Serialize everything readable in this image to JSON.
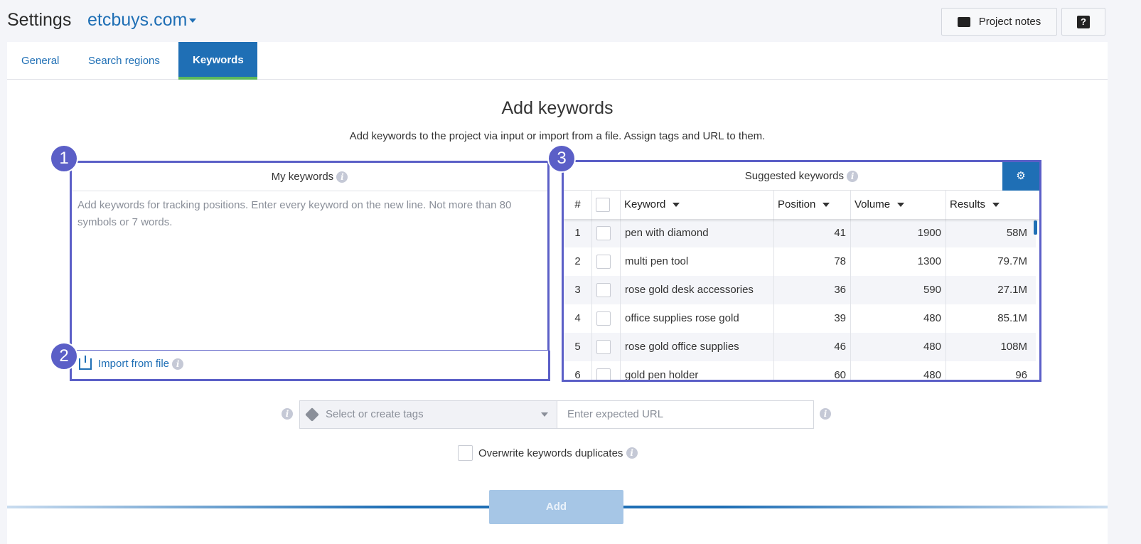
{
  "header": {
    "title": "Settings",
    "project": "etcbuys.com",
    "project_notes": "Project notes",
    "help": "?"
  },
  "tabs": [
    {
      "label": "General"
    },
    {
      "label": "Search regions"
    },
    {
      "label": "Keywords",
      "active": true
    }
  ],
  "main": {
    "title": "Add keywords",
    "subtitle": "Add keywords to the project via input or import from a file. Assign tags and URL to them."
  },
  "my_keywords": {
    "badge": "1",
    "title": "My keywords",
    "placeholder": "Add keywords for tracking positions. Enter every keyword on the new line. Not more than 80 symbols or 7 words."
  },
  "import": {
    "badge": "2",
    "label": "Import from file"
  },
  "suggested": {
    "badge": "3",
    "title": "Suggested keywords",
    "columns": [
      "#",
      "Keyword",
      "Position",
      "Volume",
      "Results"
    ],
    "rows": [
      {
        "n": "1",
        "keyword": "pen with diamond",
        "position": "41",
        "volume": "1900",
        "results": "58M"
      },
      {
        "n": "2",
        "keyword": "multi pen tool",
        "position": "78",
        "volume": "1300",
        "results": "79.7M"
      },
      {
        "n": "3",
        "keyword": "rose gold desk accessories",
        "position": "36",
        "volume": "590",
        "results": "27.1M"
      },
      {
        "n": "4",
        "keyword": "office supplies rose gold",
        "position": "39",
        "volume": "480",
        "results": "85.1M"
      },
      {
        "n": "5",
        "keyword": "rose gold office supplies",
        "position": "46",
        "volume": "480",
        "results": "108M"
      },
      {
        "n": "6",
        "keyword": "gold pen holder",
        "position": "60",
        "volume": "480",
        "results": "96"
      }
    ]
  },
  "form": {
    "tags_placeholder": "Select or create tags",
    "url_placeholder": "Enter expected URL",
    "overwrite_label": "Overwrite keywords duplicates",
    "add": "Add"
  },
  "colors": {
    "accent": "#1f6fb5",
    "annotation": "#5b5fc7",
    "active_tab_underline": "#5cb85c"
  }
}
